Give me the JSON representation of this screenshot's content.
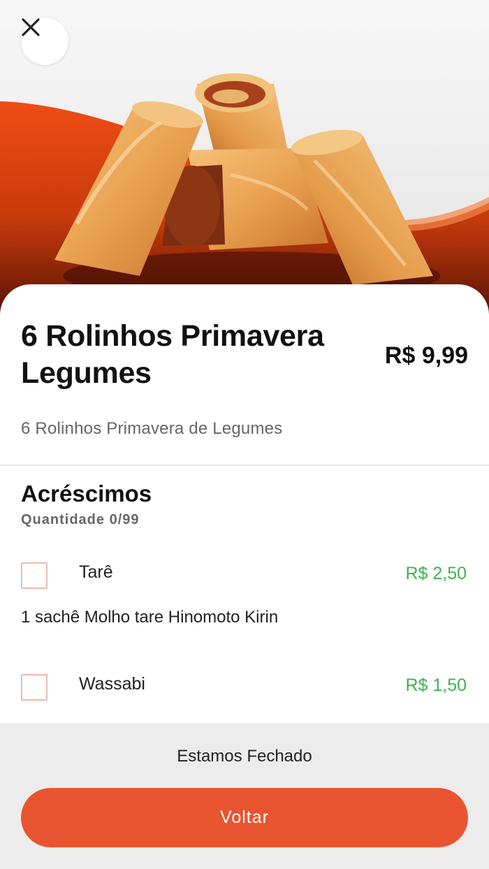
{
  "product": {
    "title": "6 Rolinhos Primavera Legumes",
    "price": "R$ 9,99",
    "description": "6 Rolinhos Primavera de Legumes"
  },
  "addons_section": {
    "title": "Acréscimos",
    "quantity_label": "Quantidade 0/99",
    "items": [
      {
        "name": "Tarê",
        "price": "R$ 2,50",
        "description": "1 sachê Molho tare Hinomoto Kirin",
        "checked": false
      },
      {
        "name": "Wassabi",
        "price": "R$ 1,50",
        "checked": false
      }
    ]
  },
  "footer": {
    "status": "Estamos Fechado",
    "back_label": "Voltar"
  },
  "icons": {
    "close": "close-icon"
  },
  "colors": {
    "accent": "#e95430",
    "price_green": "#3bb54a",
    "checkbox_border": "#f2b9a6",
    "footer_bg": "#ececec"
  }
}
